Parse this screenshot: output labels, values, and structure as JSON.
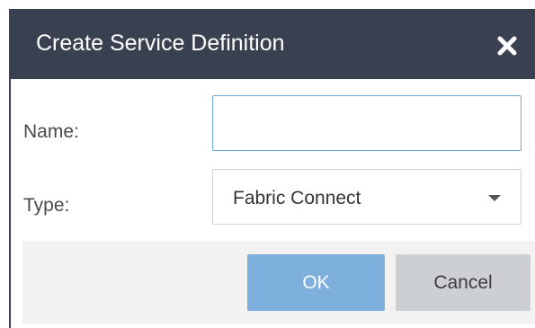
{
  "dialog": {
    "title": "Create Service Definition",
    "close_icon": "close-icon"
  },
  "form": {
    "name_label": "Name:",
    "name_value": "",
    "type_label": "Type:",
    "type_value": "Fabric Connect",
    "type_icon": "chevron-down-icon"
  },
  "buttons": {
    "ok_label": "OK",
    "cancel_label": "Cancel"
  },
  "colors": {
    "titlebar": "#39404f",
    "ok_button": "#7eb0dd",
    "cancel_button": "#cdd0d3",
    "input_focus_border": "#6fa8dc"
  }
}
